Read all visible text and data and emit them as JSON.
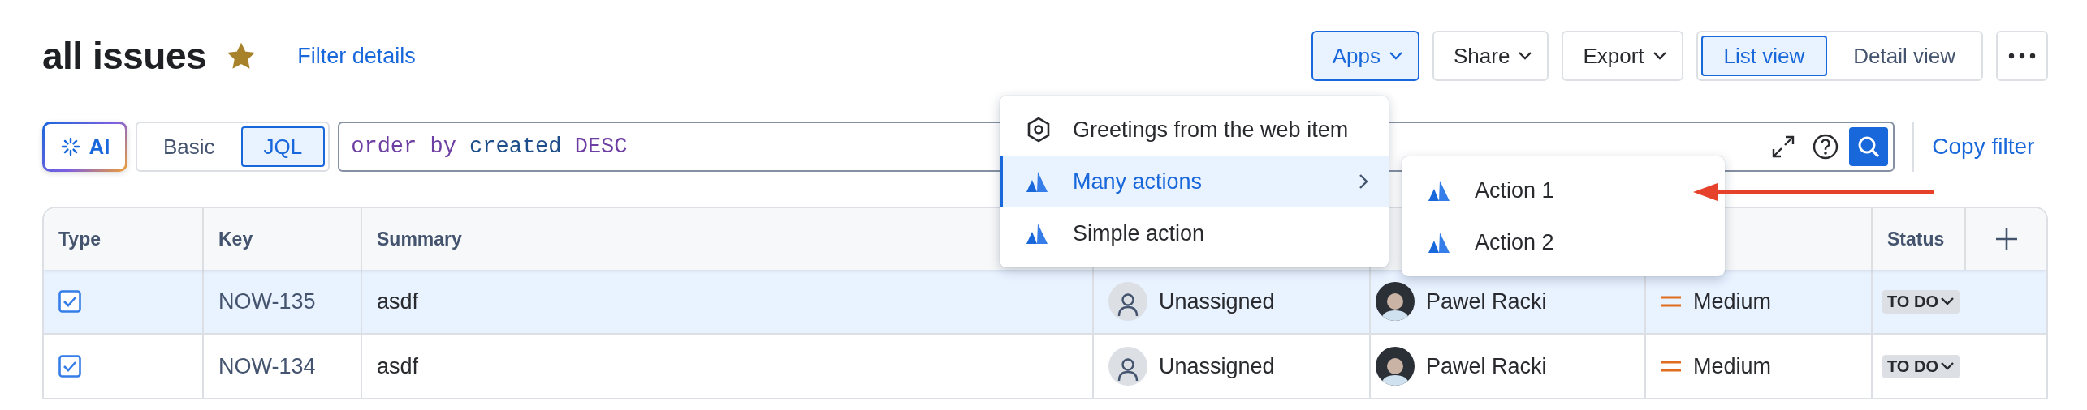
{
  "header": {
    "title": "all issues",
    "starred": true,
    "filter_details": "Filter details"
  },
  "actions": [
    {
      "label": "Apps",
      "selected": true
    },
    {
      "label": "Share",
      "selected": false
    },
    {
      "label": "Export",
      "selected": false
    }
  ],
  "view_toggle": [
    {
      "label": "List view",
      "selected": true
    },
    {
      "label": "Detail view",
      "selected": false
    }
  ],
  "search": {
    "ai_label": "AI",
    "modes": [
      {
        "label": "Basic",
        "selected": false
      },
      {
        "label": "JQL",
        "selected": true
      }
    ],
    "query": [
      {
        "text": "order by",
        "kind": "keyword"
      },
      {
        "text": "created",
        "kind": "field"
      },
      {
        "text": "DESC",
        "kind": "keyword"
      }
    ],
    "copy_filter": "Copy filter"
  },
  "table": {
    "columns": [
      {
        "label": "Type"
      },
      {
        "label": "Key"
      },
      {
        "label": "Summary"
      },
      {},
      {},
      {},
      {
        "label": "Status"
      }
    ],
    "rows": [
      {
        "selected": true,
        "key": "NOW-135",
        "summary": "asdf",
        "assignee": "Unassigned",
        "assigned": false,
        "reporter": "Pawel Racki",
        "priority": "Medium",
        "status": "TO DO"
      },
      {
        "selected": false,
        "key": "NOW-134",
        "summary": "asdf",
        "assignee": "Unassigned",
        "assigned": false,
        "reporter": "Pawel Racki",
        "priority": "Medium",
        "status": "TO DO"
      }
    ]
  },
  "apps_menu": {
    "items": [
      {
        "label": "Greetings from the web item",
        "kind": "hexagon",
        "selected": false,
        "has_submenu": false
      },
      {
        "label": "Many actions",
        "kind": "app",
        "selected": true,
        "has_submenu": true
      },
      {
        "label": "Simple action",
        "kind": "app",
        "selected": false,
        "has_submenu": false
      }
    ],
    "submenu": [
      {
        "label": "Action 1"
      },
      {
        "label": "Action 2"
      }
    ]
  }
}
